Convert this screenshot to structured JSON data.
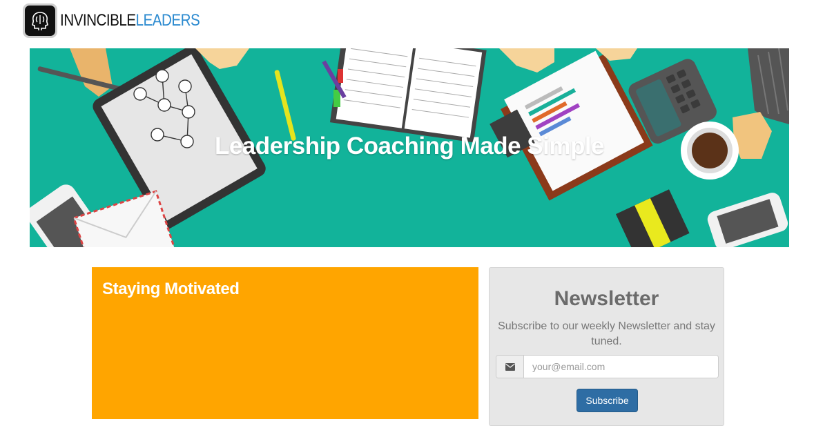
{
  "brand": {
    "name_part1": "INVINCIBLE",
    "name_part2": "LEADERS",
    "logo_icon": "head-brain-icon",
    "accent_color": "#2d8bd0"
  },
  "hero": {
    "title": "Leadership Coaching Made Simple",
    "background_color": "#12b39a"
  },
  "feature_panel": {
    "title": "Staying Motivated",
    "background_color": "#ffa500"
  },
  "newsletter": {
    "title": "Newsletter",
    "description": "Subscribe to our weekly Newsletter and stay tuned.",
    "email_placeholder": "your@email.com",
    "email_icon": "envelope-icon",
    "subscribe_label": "Subscribe",
    "button_color": "#2e6da4"
  }
}
